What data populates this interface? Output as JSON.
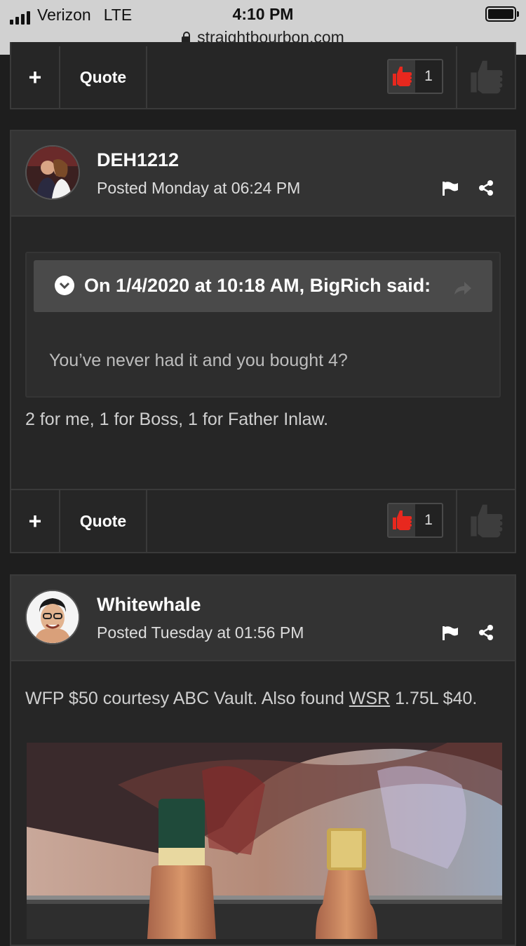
{
  "status_bar": {
    "carrier": "Verizon",
    "network": "LTE",
    "time": "4:10 PM",
    "url": "straightbourbon.com"
  },
  "colors": {
    "like_red": "#e8281e",
    "background": "#1e1e1e",
    "card": "#262626",
    "header": "#333333"
  },
  "top_actions": {
    "plus": "+",
    "quote": "Quote",
    "reputation_count": "1"
  },
  "posts": [
    {
      "author": "DEH1212",
      "posted": "Posted Monday at 06:24 PM",
      "quote": {
        "header": "On 1/4/2020 at 10:18 AM, BigRich said:",
        "text": "You’ve never had it and you bought 4?"
      },
      "body": "2 for me, 1 for Boss, 1 for Father Inlaw.",
      "actions": {
        "plus": "+",
        "quote": "Quote",
        "reputation_count": "1"
      }
    },
    {
      "author": "Whitewhale",
      "posted": "Posted Tuesday at 01:56 PM",
      "body_before_link": "WFP $50 courtesy ABC Vault.  Also found ",
      "link_text": "WSR",
      "body_after_link": " 1.75L $40."
    }
  ]
}
